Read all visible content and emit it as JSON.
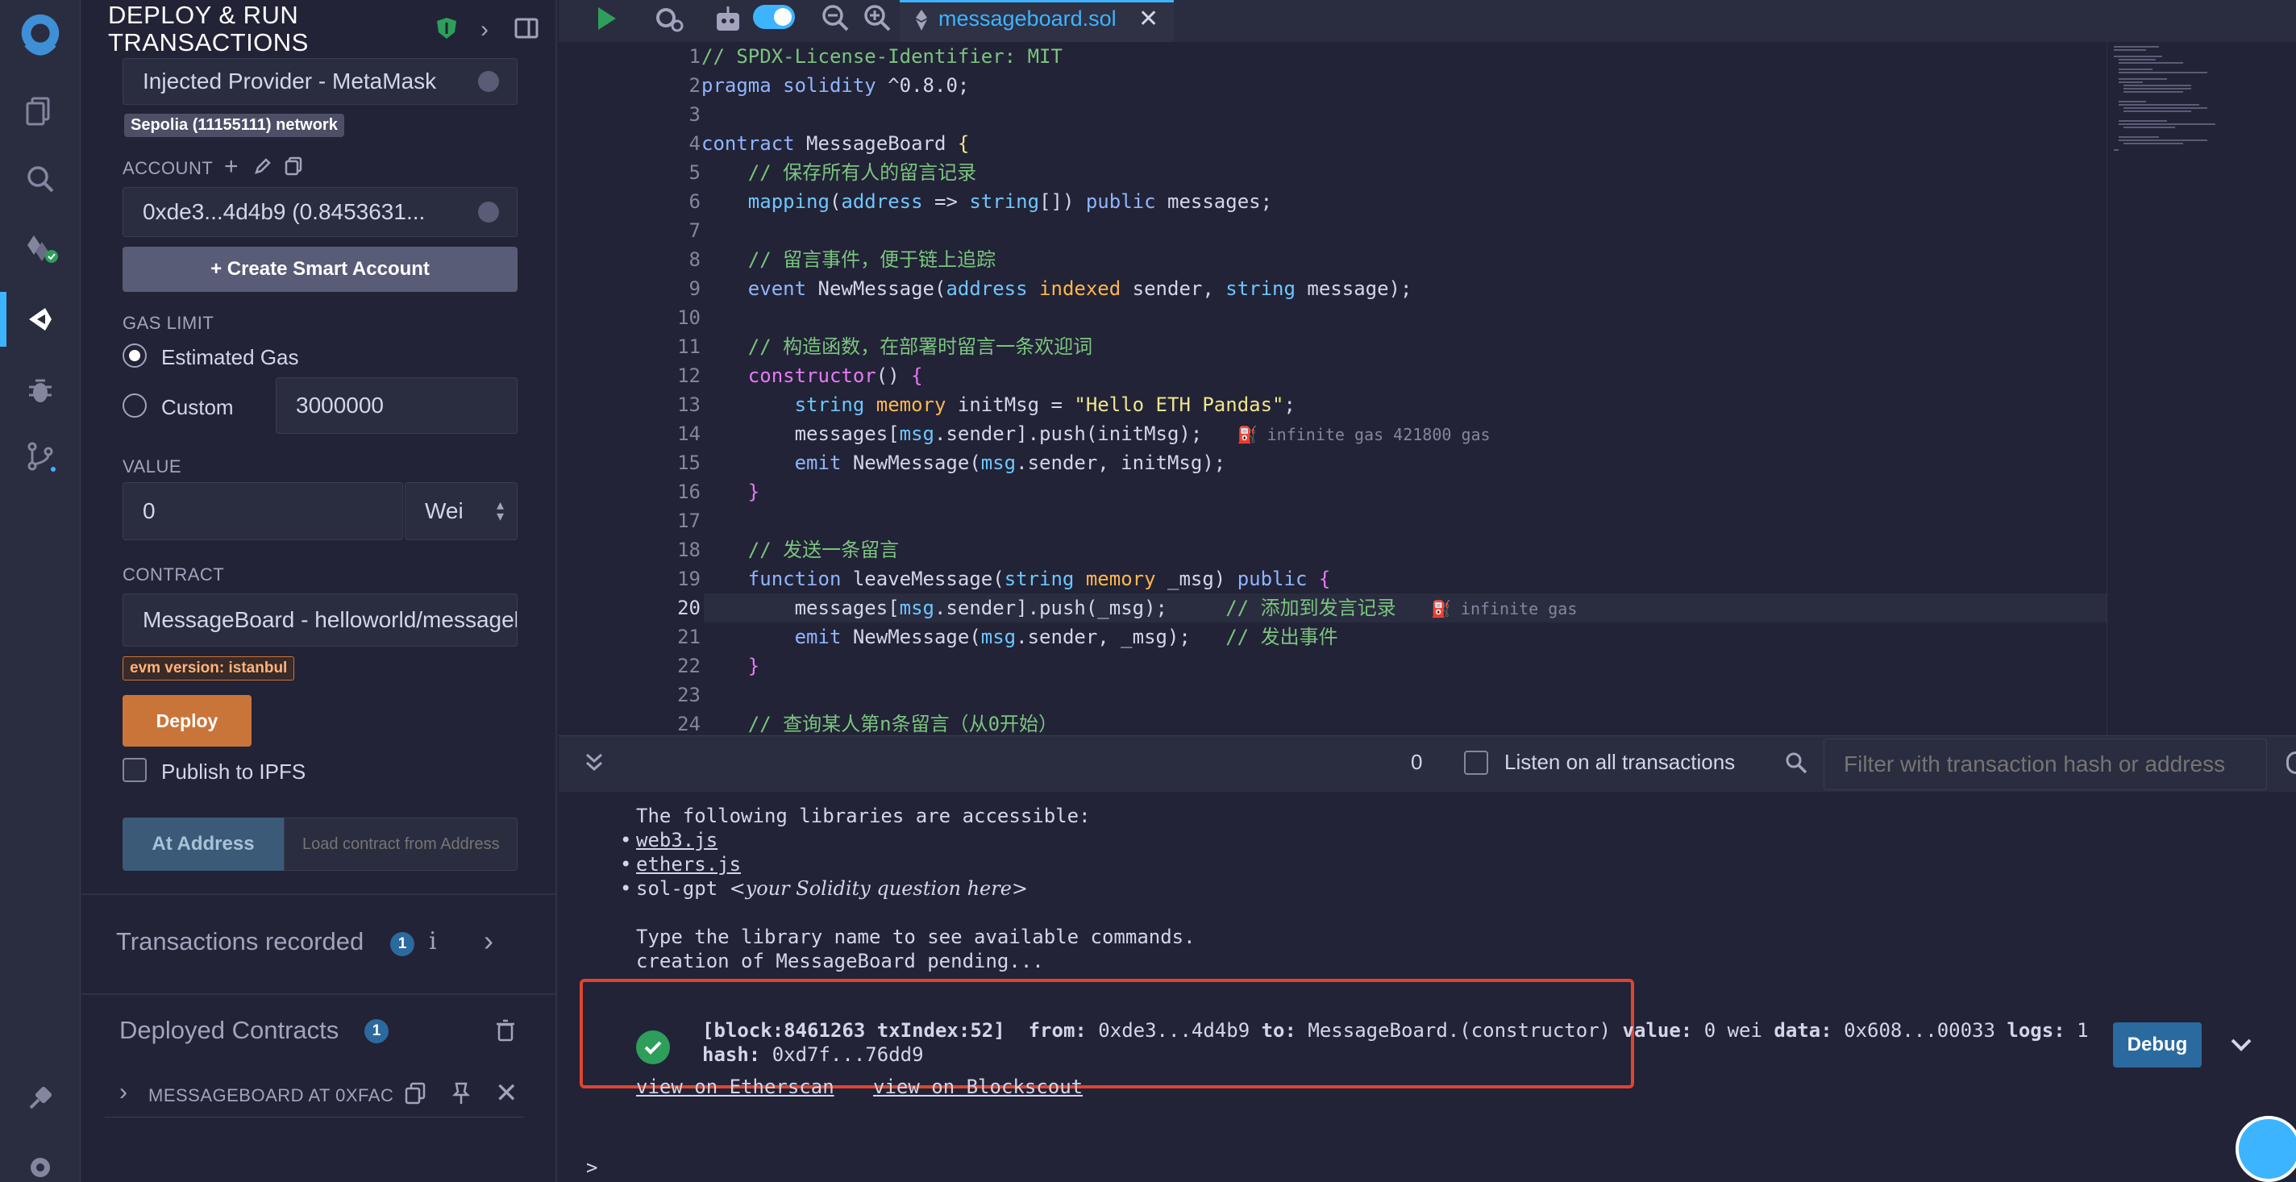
{
  "panel": {
    "title_line1": "DEPLOY & RUN",
    "title_line2": "TRANSACTIONS",
    "environment": "Injected Provider - MetaMask",
    "network_badge": "Sepolia (11155111) network",
    "account_label": "ACCOUNT",
    "account_value": "0xde3...4d4b9 (0.8453631...",
    "create_smart_account": "+ Create Smart Account",
    "gas_limit_label": "GAS LIMIT",
    "estimated_gas_label": "Estimated Gas",
    "custom_label": "Custom",
    "custom_gas_value": "3000000",
    "value_label": "VALUE",
    "value_amount": "0",
    "value_unit": "Wei",
    "contract_label": "CONTRACT",
    "contract_value": "MessageBoard - helloworld/messageboard.sol",
    "evm_badge": "evm version: istanbul",
    "deploy_button": "Deploy",
    "publish_ipfs": "Publish to IPFS",
    "at_address_button": "At Address",
    "load_contract_placeholder": "Load contract from Address",
    "transactions_recorded": "Transactions recorded",
    "transactions_count": "1",
    "deployed_contracts": "Deployed Contracts",
    "deployed_count": "1",
    "deployed_item": "MESSAGEBOARD AT 0XFAC"
  },
  "tab": {
    "filename": "messageboard.sol"
  },
  "code": [
    {
      "n": "1",
      "html": "<span class='cm'>// SPDX-License-Identifier: MIT</span>"
    },
    {
      "n": "2",
      "html": "<span class='k'>pragma</span> <span class='k'>solidity</span> ^0.8.0;"
    },
    {
      "n": "3",
      "html": ""
    },
    {
      "n": "4",
      "html": "<span class='k'>contract</span> MessageBoard <span class='st'>{</span>"
    },
    {
      "n": "5",
      "html": "    <span class='cm'>// 保存所有人的留言记录</span>"
    },
    {
      "n": "6",
      "html": "    <span class='ty'>mapping</span>(<span class='ty'>address</span> =&gt; <span class='ty'>string</span>[]) <span class='k'>public</span> messages;"
    },
    {
      "n": "7",
      "html": ""
    },
    {
      "n": "8",
      "html": "    <span class='cm'>// 留言事件，便于链上追踪</span>"
    },
    {
      "n": "9",
      "html": "    <span class='k'>event</span> NewMessage(<span class='ty'>address</span> <span class='gold'>indexed</span> sender, <span class='ty'>string</span> message);"
    },
    {
      "n": "10",
      "html": ""
    },
    {
      "n": "11",
      "html": "    <span class='cm'>// 构造函数，在部署时留言一条欢迎词</span>"
    },
    {
      "n": "12",
      "html": "    <span class='kp'>constructor</span>() <span class='kp'>{</span>"
    },
    {
      "n": "13",
      "html": "        <span class='ty'>string</span> <span class='gold'>memory</span> initMsg = <span class='st'>\"Hello ETH Pandas\"</span>;"
    },
    {
      "n": "14",
      "html": "        messages[<span class='ty'>msg</span>.sender].push(initMsg);   <span class='gas'>⛽ infinite gas 421800 gas</span>"
    },
    {
      "n": "15",
      "html": "        <span class='k'>emit</span> NewMessage(<span class='ty'>msg</span>.sender, initMsg);"
    },
    {
      "n": "16",
      "html": "    <span class='kp'>}</span>"
    },
    {
      "n": "17",
      "html": ""
    },
    {
      "n": "18",
      "html": "    <span class='cm'>// 发送一条留言</span>"
    },
    {
      "n": "19",
      "html": "    <span class='k'>function</span> leaveMessage(<span class='ty'>string</span> <span class='gold'>memory</span> _msg) <span class='k'>public</span> <span class='kp'>{</span>"
    },
    {
      "n": "20",
      "html": "        messages[<span class='ty'>msg</span>.sender].push(_msg);     <span class='cm'>// 添加到发言记录</span>   <span class='gas'>⛽ infinite gas</span>"
    },
    {
      "n": "21",
      "html": "        <span class='k'>emit</span> NewMessage(<span class='ty'>msg</span>.sender, _msg);   <span class='cm'>// 发出事件</span>"
    },
    {
      "n": "22",
      "html": "    <span class='kp'>}</span>"
    },
    {
      "n": "23",
      "html": ""
    },
    {
      "n": "24",
      "html": "    <span class='cm'>// 查询某人第n条留言（从0开始）</span>"
    }
  ],
  "terminal": {
    "count": "0",
    "listen_label": "Listen on all transactions",
    "filter_placeholder": "Filter with transaction hash or address",
    "libs_header": "The following libraries are accessible:",
    "lib1": "web3.js",
    "lib2": "ethers.js",
    "lib3_prefix": "sol-gpt ",
    "lib3_hint": "<your Solidity question here>",
    "type_hint": "Type the library name to see available commands.",
    "pending": "creation of MessageBoard pending...",
    "tx_block": "[block:8461263 txIndex:52]",
    "tx_from_label": "from:",
    "tx_from": "0xde3...4d4b9",
    "tx_to_label": "to:",
    "tx_to": "MessageBoard.(constructor)",
    "tx_value_label": "value:",
    "tx_value": "0 wei",
    "tx_data_label": "data:",
    "tx_data": "0x608...00033",
    "tx_logs_label": "logs:",
    "tx_logs": "1",
    "tx_hash_label": "hash:",
    "tx_hash": "0xd7f...76dd9",
    "view_etherscan": "view on Etherscan",
    "view_blockscout": "view on Blockscout",
    "debug_button": "Debug",
    "prompt": ">"
  },
  "colors": {
    "deploy": "#c97539",
    "debug": "#2b6a9e",
    "success": "#2e9e5b",
    "highlight_border": "#e0442f",
    "accent_blue": "#3cb4ff"
  }
}
